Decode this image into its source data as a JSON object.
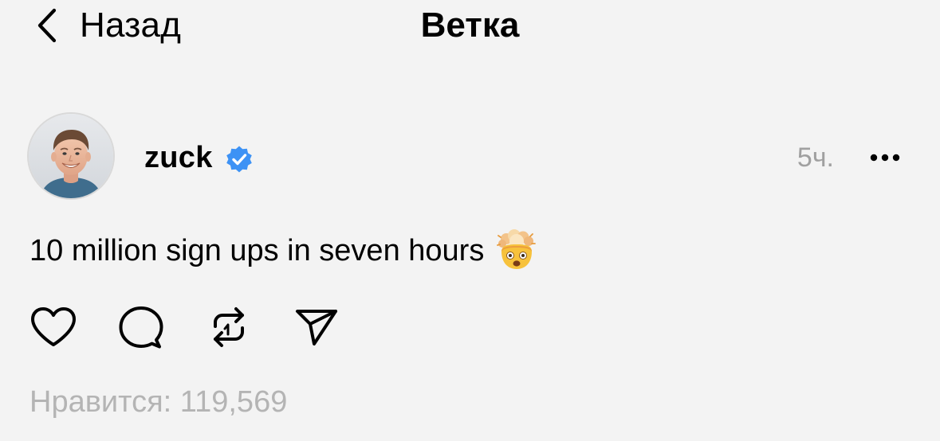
{
  "header": {
    "back_label": "Назад",
    "title": "Ветка"
  },
  "post": {
    "author": {
      "username": "zuck",
      "verified": true,
      "avatar_icon": "avatar-photo-icon"
    },
    "timestamp": "5ч.",
    "text": "10 million sign ups in seven hours",
    "emoji_icon": "exploding-head-icon",
    "actions": [
      {
        "name": "like",
        "icon": "heart-icon"
      },
      {
        "name": "comment",
        "icon": "comment-bubble-icon"
      },
      {
        "name": "repost",
        "icon": "repost-icon"
      },
      {
        "name": "share",
        "icon": "send-icon"
      }
    ],
    "likes_text": "Нравится: 119,569"
  },
  "colors": {
    "background": "#f3f3f3",
    "text": "#000000",
    "muted": "#a0a0a0",
    "likes": "#b4b4b4",
    "verified_blue": "#3d92f5"
  }
}
